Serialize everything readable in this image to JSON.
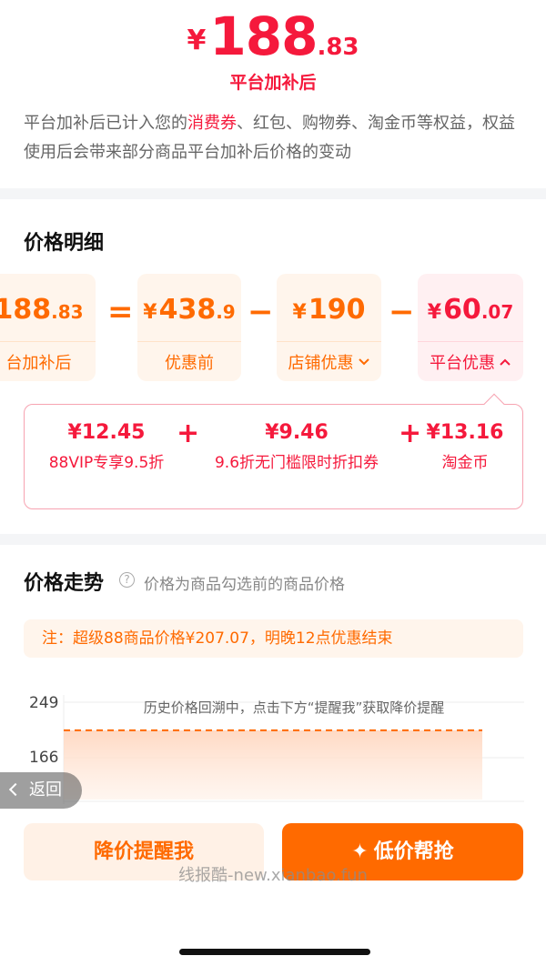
{
  "header": {
    "currency": "¥",
    "price_int": "188",
    "price_dec": ".83",
    "label": "平台加补后",
    "notice_before": "平台加补后已计入您的",
    "notice_highlight": "消费券",
    "notice_after": "、红包、购物券、淘金币等权益，权益使用后会带来部分商品平台加补后价格的变动"
  },
  "detail": {
    "title": "价格明细",
    "equation": {
      "result": {
        "value_int": "188",
        "value_dec": ".83",
        "label": "台加补后"
      },
      "equals": "=",
      "before": {
        "currency": "¥",
        "value_int": "438",
        "value_dec": ".9",
        "label": "优惠前"
      },
      "minus1": "−",
      "shop": {
        "currency": "¥",
        "value_int": "190",
        "label": "店铺优惠"
      },
      "minus2": "−",
      "platform": {
        "currency": "¥",
        "value_int": "60",
        "value_dec": ".07",
        "label": "平台优惠"
      }
    },
    "breakdown": [
      {
        "value": "¥12.45",
        "name": "88VIP专享9.5折"
      },
      {
        "value": "¥9.46",
        "name": "9.6折无门槛限时折扣券"
      },
      {
        "value": "¥13.16",
        "name": "淘金币"
      }
    ],
    "plus": "+"
  },
  "trend": {
    "title": "价格走势",
    "help_icon": "question-icon",
    "subtitle": "价格为商品勾选前的商品价格",
    "note": "注：超级88商品价格¥207.07，明晚12点优惠结束",
    "chart_message": "历史价格回溯中，点击下方“提醒我”获取降价提醒"
  },
  "chart_data": {
    "type": "area",
    "y_ticks": [
      "249",
      "166"
    ],
    "ylim": [
      140,
      260
    ],
    "series": [
      {
        "values": [
          207.07,
          207.07
        ]
      }
    ],
    "colors": {
      "line": "#ff6a00",
      "fill": "#ffd9c2"
    }
  },
  "footer": {
    "back_label": "返回",
    "remind_label": "降价提醒我",
    "grab_label": "低价帮抢",
    "grab_icon": "sparkle-icon",
    "watermark": "线报酷-new.xianbao.fun"
  },
  "colors": {
    "accent_red": "#f5193c",
    "accent_orange": "#ff6a00"
  }
}
